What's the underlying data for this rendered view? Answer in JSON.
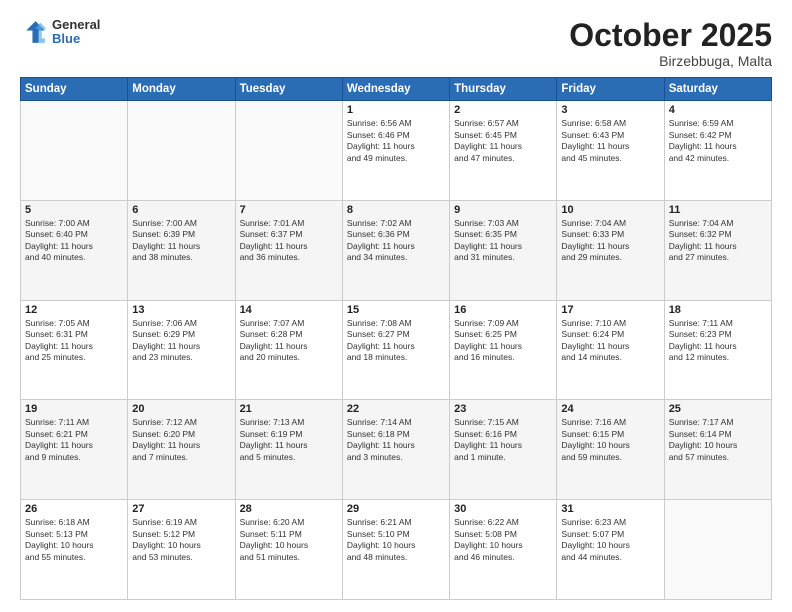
{
  "header": {
    "logo": {
      "general": "General",
      "blue": "Blue"
    },
    "title": "October 2025",
    "location": "Birzebbuga, Malta"
  },
  "weekdays": [
    "Sunday",
    "Monday",
    "Tuesday",
    "Wednesday",
    "Thursday",
    "Friday",
    "Saturday"
  ],
  "weeks": [
    [
      {
        "day": "",
        "info": ""
      },
      {
        "day": "",
        "info": ""
      },
      {
        "day": "",
        "info": ""
      },
      {
        "day": "1",
        "info": "Sunrise: 6:56 AM\nSunset: 6:46 PM\nDaylight: 11 hours\nand 49 minutes."
      },
      {
        "day": "2",
        "info": "Sunrise: 6:57 AM\nSunset: 6:45 PM\nDaylight: 11 hours\nand 47 minutes."
      },
      {
        "day": "3",
        "info": "Sunrise: 6:58 AM\nSunset: 6:43 PM\nDaylight: 11 hours\nand 45 minutes."
      },
      {
        "day": "4",
        "info": "Sunrise: 6:59 AM\nSunset: 6:42 PM\nDaylight: 11 hours\nand 42 minutes."
      }
    ],
    [
      {
        "day": "5",
        "info": "Sunrise: 7:00 AM\nSunset: 6:40 PM\nDaylight: 11 hours\nand 40 minutes."
      },
      {
        "day": "6",
        "info": "Sunrise: 7:00 AM\nSunset: 6:39 PM\nDaylight: 11 hours\nand 38 minutes."
      },
      {
        "day": "7",
        "info": "Sunrise: 7:01 AM\nSunset: 6:37 PM\nDaylight: 11 hours\nand 36 minutes."
      },
      {
        "day": "8",
        "info": "Sunrise: 7:02 AM\nSunset: 6:36 PM\nDaylight: 11 hours\nand 34 minutes."
      },
      {
        "day": "9",
        "info": "Sunrise: 7:03 AM\nSunset: 6:35 PM\nDaylight: 11 hours\nand 31 minutes."
      },
      {
        "day": "10",
        "info": "Sunrise: 7:04 AM\nSunset: 6:33 PM\nDaylight: 11 hours\nand 29 minutes."
      },
      {
        "day": "11",
        "info": "Sunrise: 7:04 AM\nSunset: 6:32 PM\nDaylight: 11 hours\nand 27 minutes."
      }
    ],
    [
      {
        "day": "12",
        "info": "Sunrise: 7:05 AM\nSunset: 6:31 PM\nDaylight: 11 hours\nand 25 minutes."
      },
      {
        "day": "13",
        "info": "Sunrise: 7:06 AM\nSunset: 6:29 PM\nDaylight: 11 hours\nand 23 minutes."
      },
      {
        "day": "14",
        "info": "Sunrise: 7:07 AM\nSunset: 6:28 PM\nDaylight: 11 hours\nand 20 minutes."
      },
      {
        "day": "15",
        "info": "Sunrise: 7:08 AM\nSunset: 6:27 PM\nDaylight: 11 hours\nand 18 minutes."
      },
      {
        "day": "16",
        "info": "Sunrise: 7:09 AM\nSunset: 6:25 PM\nDaylight: 11 hours\nand 16 minutes."
      },
      {
        "day": "17",
        "info": "Sunrise: 7:10 AM\nSunset: 6:24 PM\nDaylight: 11 hours\nand 14 minutes."
      },
      {
        "day": "18",
        "info": "Sunrise: 7:11 AM\nSunset: 6:23 PM\nDaylight: 11 hours\nand 12 minutes."
      }
    ],
    [
      {
        "day": "19",
        "info": "Sunrise: 7:11 AM\nSunset: 6:21 PM\nDaylight: 11 hours\nand 9 minutes."
      },
      {
        "day": "20",
        "info": "Sunrise: 7:12 AM\nSunset: 6:20 PM\nDaylight: 11 hours\nand 7 minutes."
      },
      {
        "day": "21",
        "info": "Sunrise: 7:13 AM\nSunset: 6:19 PM\nDaylight: 11 hours\nand 5 minutes."
      },
      {
        "day": "22",
        "info": "Sunrise: 7:14 AM\nSunset: 6:18 PM\nDaylight: 11 hours\nand 3 minutes."
      },
      {
        "day": "23",
        "info": "Sunrise: 7:15 AM\nSunset: 6:16 PM\nDaylight: 11 hours\nand 1 minute."
      },
      {
        "day": "24",
        "info": "Sunrise: 7:16 AM\nSunset: 6:15 PM\nDaylight: 10 hours\nand 59 minutes."
      },
      {
        "day": "25",
        "info": "Sunrise: 7:17 AM\nSunset: 6:14 PM\nDaylight: 10 hours\nand 57 minutes."
      }
    ],
    [
      {
        "day": "26",
        "info": "Sunrise: 6:18 AM\nSunset: 5:13 PM\nDaylight: 10 hours\nand 55 minutes."
      },
      {
        "day": "27",
        "info": "Sunrise: 6:19 AM\nSunset: 5:12 PM\nDaylight: 10 hours\nand 53 minutes."
      },
      {
        "day": "28",
        "info": "Sunrise: 6:20 AM\nSunset: 5:11 PM\nDaylight: 10 hours\nand 51 minutes."
      },
      {
        "day": "29",
        "info": "Sunrise: 6:21 AM\nSunset: 5:10 PM\nDaylight: 10 hours\nand 48 minutes."
      },
      {
        "day": "30",
        "info": "Sunrise: 6:22 AM\nSunset: 5:08 PM\nDaylight: 10 hours\nand 46 minutes."
      },
      {
        "day": "31",
        "info": "Sunrise: 6:23 AM\nSunset: 5:07 PM\nDaylight: 10 hours\nand 44 minutes."
      },
      {
        "day": "",
        "info": ""
      }
    ]
  ]
}
